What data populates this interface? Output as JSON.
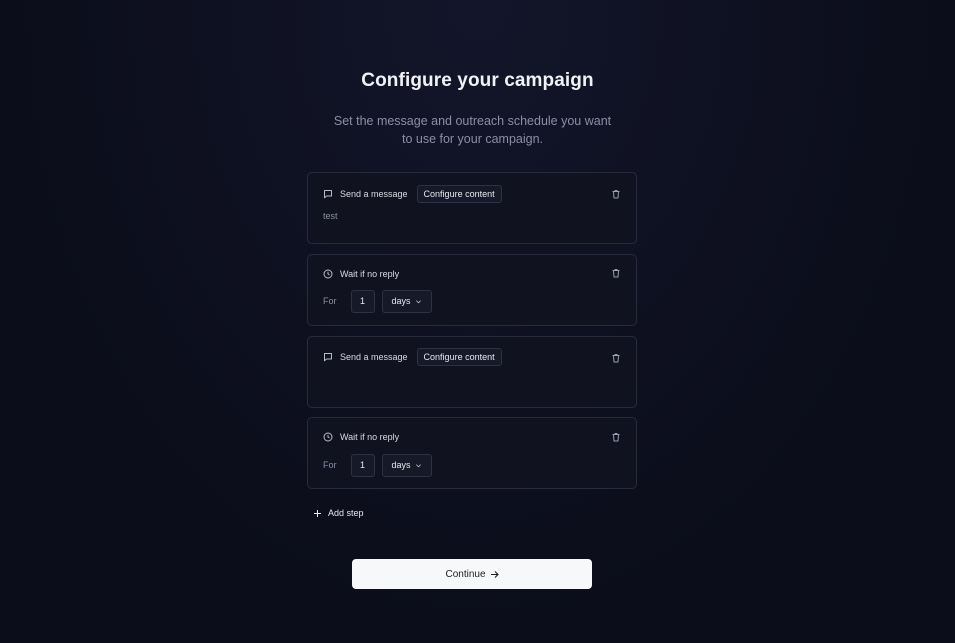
{
  "header": {
    "title": "Configure your campaign",
    "subtitle": "Set the message and outreach schedule you want to use for your campaign."
  },
  "steps": [
    {
      "type": "message",
      "icon": "chat-bubble-icon",
      "label": "Send a message",
      "configure_label": "Configure content",
      "content": "test"
    },
    {
      "type": "wait",
      "icon": "clock-icon",
      "label": "Wait if no reply",
      "for_label": "For",
      "amount": "1",
      "unit": "days"
    },
    {
      "type": "message",
      "icon": "chat-bubble-icon",
      "label": "Send a message",
      "configure_label": "Configure content",
      "content": ""
    },
    {
      "type": "wait",
      "icon": "clock-icon",
      "label": "Wait if no reply",
      "for_label": "For",
      "amount": "1",
      "unit": "days"
    }
  ],
  "add_step_label": "Add step",
  "continue_label": "Continue",
  "colors": {
    "background": "#0b0d1a",
    "card": "#10131f",
    "border": "#272b3b",
    "primary_button": "#f7f8fa"
  }
}
